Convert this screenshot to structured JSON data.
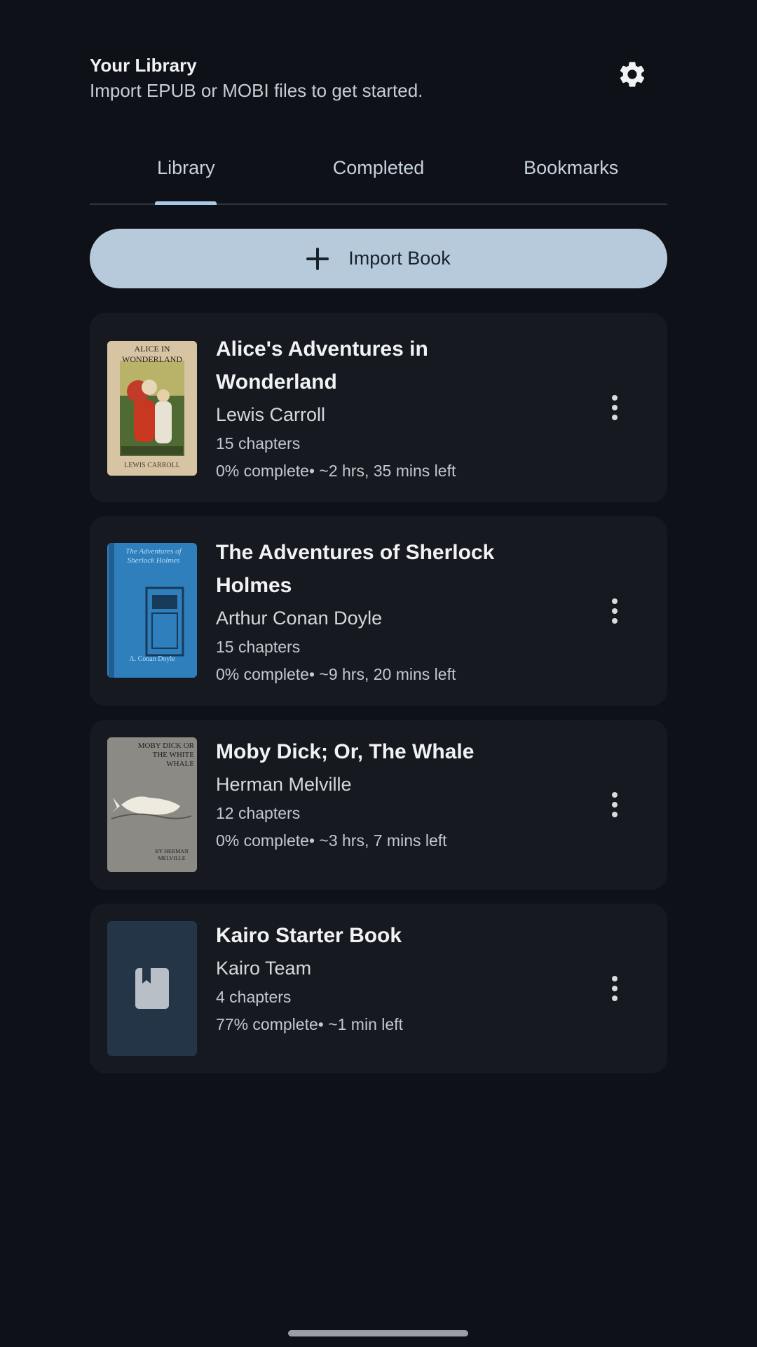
{
  "header": {
    "title": "Your Library",
    "subtitle": "Import EPUB or MOBI files to get started."
  },
  "icons": {
    "settings": "gear-icon",
    "import": "plus-icon",
    "more": "more-vertical-icon",
    "placeholder_cover": "bookmark-icon"
  },
  "tabs": [
    {
      "label": "Library",
      "active": true
    },
    {
      "label": "Completed",
      "active": false
    },
    {
      "label": "Bookmarks",
      "active": false
    }
  ],
  "import_button": {
    "label": "Import Book"
  },
  "books": [
    {
      "title": "Alice's Adventures in Wonderland",
      "author": "Lewis Carroll",
      "chapters": "15 chapters",
      "progress": "0% complete• ~2 hrs, 35 mins left",
      "cover": {
        "top_text": "ALICE IN WONDERLAND",
        "bottom_text": "LEWIS CARROLL"
      }
    },
    {
      "title": "The Adventures of Sherlock Holmes",
      "author": "Arthur Conan Doyle",
      "chapters": "15 chapters",
      "progress": "0% complete• ~9 hrs, 20 mins left",
      "cover": {
        "top_text": "The Adventures of Sherlock Holmes",
        "bottom_text": "A. Conan Doyle"
      }
    },
    {
      "title": "Moby Dick; Or, The Whale",
      "author": "Herman Melville",
      "chapters": "12 chapters",
      "progress": "0% complete• ~3 hrs, 7 mins left",
      "cover": {
        "top_text": "MOBY DICK OR THE WHITE WHALE",
        "bottom_text": "BY HERMAN MELVILLE"
      }
    },
    {
      "title": "Kairo Starter Book",
      "author": "Kairo Team",
      "chapters": "4 chapters",
      "progress": "77% complete• ~1 min left",
      "cover": null
    }
  ],
  "colors": {
    "background": "#0e1117",
    "card": "#16191f",
    "accent": "#a8c8e8",
    "import_button": "#b7cadb"
  }
}
